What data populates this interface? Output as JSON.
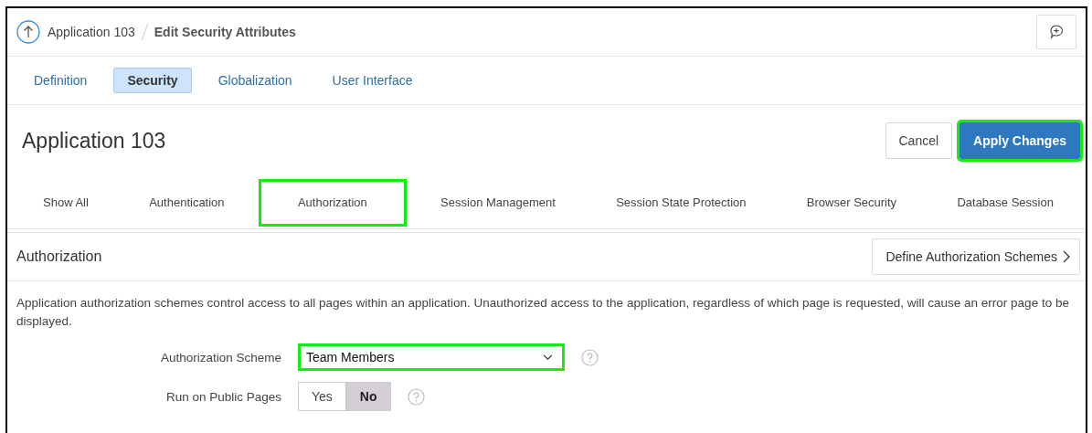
{
  "breadcrumb": {
    "parent": "Application 103",
    "current": "Edit Security Attributes"
  },
  "tabs": [
    {
      "label": "Definition",
      "selected": false
    },
    {
      "label": "Security",
      "selected": true
    },
    {
      "label": "Globalization",
      "selected": false
    },
    {
      "label": "User Interface",
      "selected": false
    }
  ],
  "page_title": "Application 103",
  "buttons": [
    {
      "label": "Cancel",
      "kind": "secondary",
      "highlighted": false
    },
    {
      "label": "Apply Changes",
      "kind": "primary",
      "highlighted": true
    }
  ],
  "section_nav": [
    {
      "label": "Show All",
      "highlighted": false
    },
    {
      "label": "Authentication",
      "highlighted": false
    },
    {
      "label": "Authorization",
      "highlighted": true
    },
    {
      "label": "Session Management",
      "highlighted": false
    },
    {
      "label": "Session State Protection",
      "highlighted": false
    },
    {
      "label": "Browser Security",
      "highlighted": false
    },
    {
      "label": "Database Session",
      "highlighted": false
    }
  ],
  "region": {
    "title": "Authorization",
    "action": "Define Authorization Schemes",
    "description": "Application authorization schemes control access to all pages within an application. Unauthorized access to the application, regardless of which page is requested, will cause an error page to be displayed.",
    "fields": [
      {
        "kind": "select",
        "label": "Authorization Scheme",
        "value": "Team Members",
        "highlighted": true
      },
      {
        "kind": "toggle",
        "label": "Run on Public Pages",
        "options": [
          {
            "label": "Yes",
            "selected": false
          },
          {
            "label": "No",
            "selected": true
          }
        ]
      }
    ]
  }
}
